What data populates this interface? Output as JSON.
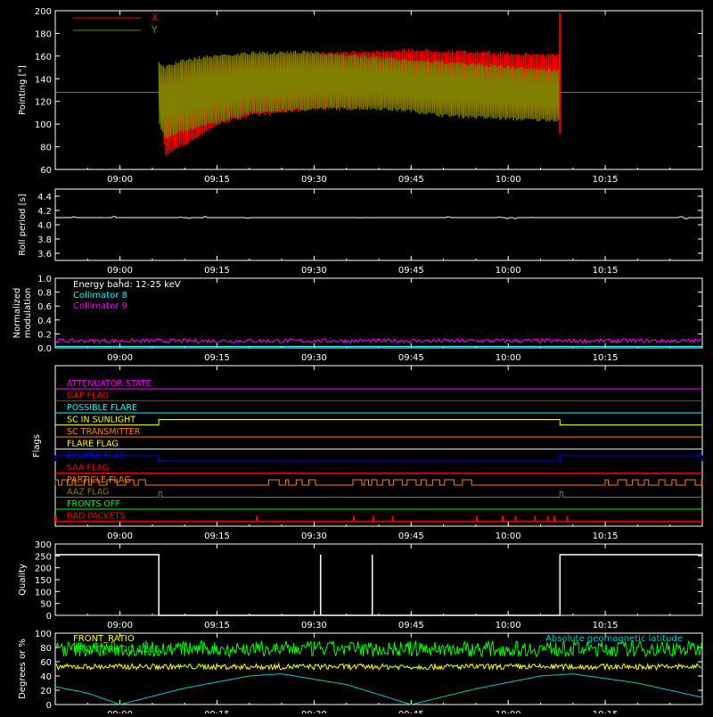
{
  "colors": {
    "background": "#000000",
    "axes": "#ffffff",
    "x_pointing": "#ff0000",
    "y_pointing": "#808000",
    "collimator8": "#00ffff",
    "collimator9": "#ff00ff",
    "front_ratio": "#ffff00",
    "front_ratio_alt": "#00ff00",
    "geomag": "#00c8c8"
  },
  "time_axis": {
    "start": "08:50",
    "end": "10:30",
    "ticks": [
      "09:00",
      "09:15",
      "09:30",
      "09:45",
      "10:00",
      "10:15"
    ]
  },
  "chart_data": [
    {
      "type": "area",
      "ylabel": "Pointing [\"]",
      "ylim": [
        60,
        200
      ],
      "yticks": [
        60,
        80,
        100,
        120,
        140,
        160,
        180,
        200
      ],
      "legend_placement": "top-left",
      "series": [
        {
          "name": "X",
          "color": "#ff0000",
          "baseline": 128,
          "envelope_upper": [
            [
              "09:06",
              128
            ],
            [
              "09:07",
              148
            ],
            [
              "09:08",
              152
            ],
            [
              "09:10",
              154
            ],
            [
              "09:15",
              157
            ],
            [
              "09:20",
              160
            ],
            [
              "09:30",
              163
            ],
            [
              "09:40",
              166
            ],
            [
              "09:45",
              167
            ],
            [
              "09:50",
              166
            ],
            [
              "10:00",
              164
            ],
            [
              "10:05",
              163
            ],
            [
              "10:08",
              163
            ]
          ],
          "envelope_lower": [
            [
              "09:06",
              128
            ],
            [
              "09:07",
              70
            ],
            [
              "09:08",
              75
            ],
            [
              "09:10",
              80
            ],
            [
              "09:15",
              98
            ],
            [
              "09:20",
              106
            ],
            [
              "09:30",
              112
            ],
            [
              "09:40",
              115
            ],
            [
              "09:45",
              114
            ],
            [
              "09:50",
              112
            ],
            [
              "10:00",
              108
            ],
            [
              "10:05",
              106
            ],
            [
              "10:08",
              107
            ]
          ]
        },
        {
          "name": "Y",
          "color": "#808000",
          "baseline": 128,
          "envelope_upper": [
            [
              "09:06",
              155
            ],
            [
              "09:07",
              152
            ],
            [
              "09:10",
              158
            ],
            [
              "09:15",
              162
            ],
            [
              "09:20",
              164
            ],
            [
              "09:30",
              165
            ],
            [
              "09:40",
              160
            ],
            [
              "09:45",
              158
            ],
            [
              "09:50",
              156
            ],
            [
              "10:00",
              152
            ],
            [
              "10:05",
              150
            ],
            [
              "10:08",
              149
            ]
          ],
          "envelope_lower": [
            [
              "09:06",
              100
            ],
            [
              "09:07",
              86
            ],
            [
              "09:10",
              92
            ],
            [
              "09:15",
              100
            ],
            [
              "09:20",
              108
            ],
            [
              "09:30",
              112
            ],
            [
              "09:40",
              112
            ],
            [
              "09:45",
              110
            ],
            [
              "09:50",
              106
            ],
            [
              "10:00",
              103
            ],
            [
              "10:05",
              102
            ],
            [
              "10:08",
              102
            ]
          ]
        }
      ]
    },
    {
      "type": "line",
      "ylabel": "Roll period [s]",
      "ylim": [
        3.5,
        4.5
      ],
      "yticks": [
        3.6,
        3.8,
        4.0,
        4.2,
        4.4
      ],
      "series": [
        {
          "name": "",
          "color": "#ffffff",
          "points": [
            [
              "08:50",
              4.1
            ],
            [
              "10:30",
              4.1
            ]
          ]
        }
      ]
    },
    {
      "type": "line",
      "ylabel_lines": [
        "Normalized",
        "modulation"
      ],
      "ylim": [
        0,
        1.0
      ],
      "yticks": [
        0.0,
        0.2,
        0.4,
        0.6,
        0.8,
        1.0
      ],
      "annotations": [
        "Energy band: 12-25 keV"
      ],
      "series": [
        {
          "name": "Collimator 8",
          "color": "#00ffff",
          "level": 0.02
        },
        {
          "name": "Collimator 9",
          "color": "#ff00ff",
          "level": 0.1
        }
      ]
    },
    {
      "type": "table",
      "ylabel": "Flags",
      "flags": [
        {
          "name": "ATTENUATOR STATE",
          "color": "#ff00ff",
          "on_intervals": []
        },
        {
          "name": "GAP FLAG",
          "color": "#ff0000",
          "on_intervals": []
        },
        {
          "name": "POSSIBLE FLARE",
          "color": "#00ffff",
          "on_intervals": []
        },
        {
          "name": "SC IN SUNLIGHT",
          "color": "#ffff00",
          "on_intervals": [
            [
              "09:06",
              "10:08"
            ]
          ]
        },
        {
          "name": "SC TRANSMITTER",
          "color": "#ff8000",
          "on_intervals": []
        },
        {
          "name": "FLARE FLAG",
          "color": "#ffff00",
          "on_intervals": []
        },
        {
          "name": "ECLIPSE FLAG",
          "color": "#0000ff",
          "on_intervals": [
            [
              "08:50",
              "09:06"
            ],
            [
              "10:08",
              "10:30"
            ]
          ]
        },
        {
          "name": "SAA FLAG",
          "color": "#ff0000",
          "on_intervals": []
        },
        {
          "name": "PARTICLE FLAG",
          "color": "#ff8000",
          "on_intervals": [
            [
              "08:50",
              "09:05"
            ],
            [
              "09:23",
              "09:31"
            ],
            [
              "09:36",
              "09:55"
            ],
            [
              "10:15",
              "10:30"
            ]
          ]
        },
        {
          "name": "AAZ FLAG",
          "color": "#808000",
          "on_intervals": [
            [
              "09:06",
              "09:06"
            ],
            [
              "10:08",
              "10:08"
            ]
          ]
        },
        {
          "name": "FRONTS OFF",
          "color": "#00ff00",
          "on_intervals": []
        },
        {
          "name": "BAD PACKETS",
          "color": "#ff0000",
          "on_intervals": [
            [
              "08:50",
              "08:50"
            ],
            [
              "09:21",
              "09:21"
            ],
            [
              "09:36",
              "09:36"
            ],
            [
              "09:39",
              "09:39"
            ],
            [
              "09:42",
              "09:42"
            ],
            [
              "09:55",
              "09:55"
            ],
            [
              "09:59",
              "09:59"
            ],
            [
              "10:01",
              "10:01"
            ],
            [
              "10:04",
              "10:04"
            ],
            [
              "10:06",
              "10:06"
            ],
            [
              "10:07",
              "10:07"
            ],
            [
              "10:09",
              "10:09"
            ]
          ]
        }
      ]
    },
    {
      "type": "line",
      "ylabel": "Quality",
      "ylim": [
        0,
        300
      ],
      "yticks": [
        0,
        50,
        100,
        150,
        200,
        250,
        300
      ],
      "series": [
        {
          "name": "",
          "color": "#ffffff",
          "points": [
            [
              "08:50",
              255
            ],
            [
              "09:06",
              255
            ],
            [
              "09:06",
              0
            ],
            [
              "09:31",
              0
            ],
            [
              "09:31",
              255
            ],
            [
              "09:31",
              0
            ],
            [
              "09:39",
              0
            ],
            [
              "09:39",
              255
            ],
            [
              "09:39",
              0
            ],
            [
              "10:08",
              0
            ],
            [
              "10:08",
              255
            ],
            [
              "10:30",
              255
            ]
          ]
        }
      ]
    },
    {
      "type": "line",
      "ylabel": "Degrees or %",
      "ylim": [
        0,
        100
      ],
      "yticks": [
        0,
        20,
        40,
        60,
        80,
        100
      ],
      "series": [
        {
          "name": "FRONT_RATIO",
          "color": "#ffff00",
          "level": 53
        },
        {
          "name": "FRONT_RATIO 1265",
          "color": "#00ff00",
          "level": 78
        },
        {
          "name": "Absolute geomagnetic latitude",
          "color": "#00c8c8",
          "points": [
            [
              "08:50",
              25
            ],
            [
              "08:55",
              16
            ],
            [
              "09:00",
              0
            ],
            [
              "09:10",
              23
            ],
            [
              "09:20",
              40
            ],
            [
              "09:25",
              43
            ],
            [
              "09:35",
              28
            ],
            [
              "09:45",
              0
            ],
            [
              "09:55",
              22
            ],
            [
              "10:05",
              40
            ],
            [
              "10:10",
              43
            ],
            [
              "10:20",
              30
            ],
            [
              "10:30",
              10
            ]
          ]
        }
      ]
    }
  ]
}
